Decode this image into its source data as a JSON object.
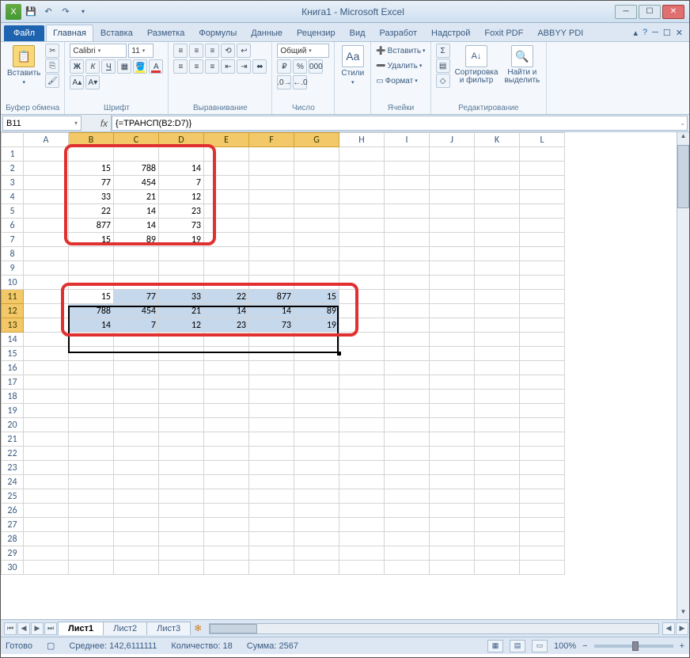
{
  "titlebar": {
    "title": "Книга1 - Microsoft Excel"
  },
  "tabs": {
    "file": "Файл",
    "items": [
      "Главная",
      "Вставка",
      "Разметка",
      "Формулы",
      "Данные",
      "Рецензир",
      "Вид",
      "Разработ",
      "Надстрой",
      "Foxit PDF",
      "ABBYY PDI"
    ],
    "active": 0
  },
  "ribbon": {
    "clipboard": {
      "label": "Буфер обмена",
      "paste": "Вставить"
    },
    "font": {
      "label": "Шрифт",
      "name": "Calibri",
      "size": "11"
    },
    "alignment": {
      "label": "Выравнивание"
    },
    "number": {
      "label": "Число",
      "format": "Общий"
    },
    "styles": {
      "label": "Стили",
      "btn": "Стили"
    },
    "cells": {
      "label": "Ячейки",
      "insert": "Вставить",
      "delete": "Удалить",
      "format": "Формат"
    },
    "editing": {
      "label": "Редактирование",
      "sort": "Сортировка\nи фильтр",
      "find": "Найти и\nвыделить"
    }
  },
  "namebox": "B11",
  "formula": "{=ТРАНСП(B2:D7)}",
  "columns": [
    "A",
    "B",
    "C",
    "D",
    "E",
    "F",
    "G",
    "H",
    "I",
    "J",
    "K",
    "L"
  ],
  "rowcount": 30,
  "data1": {
    "rows": [
      {
        "r": 2,
        "B": "15",
        "C": "788",
        "D": "14"
      },
      {
        "r": 3,
        "B": "77",
        "C": "454",
        "D": "7"
      },
      {
        "r": 4,
        "B": "33",
        "C": "21",
        "D": "12"
      },
      {
        "r": 5,
        "B": "22",
        "C": "14",
        "D": "23"
      },
      {
        "r": 6,
        "B": "877",
        "C": "14",
        "D": "73"
      },
      {
        "r": 7,
        "B": "15",
        "C": "89",
        "D": "19"
      }
    ]
  },
  "data2": {
    "rows": [
      {
        "r": 11,
        "B": "15",
        "C": "77",
        "D": "33",
        "E": "22",
        "F": "877",
        "G": "15"
      },
      {
        "r": 12,
        "B": "788",
        "C": "454",
        "D": "21",
        "E": "14",
        "F": "14",
        "G": "89"
      },
      {
        "r": 13,
        "B": "14",
        "C": "7",
        "D": "12",
        "E": "23",
        "F": "73",
        "G": "19"
      }
    ]
  },
  "selection": {
    "startCol": "B",
    "endCol": "G",
    "startRow": 11,
    "endRow": 13
  },
  "sheets": {
    "tabs": [
      "Лист1",
      "Лист2",
      "Лист3"
    ],
    "active": 0
  },
  "status": {
    "ready": "Готово",
    "avg_label": "Среднее:",
    "avg": "142,6111111",
    "count_label": "Количество:",
    "count": "18",
    "sum_label": "Сумма:",
    "sum": "2567",
    "zoom": "100%"
  }
}
